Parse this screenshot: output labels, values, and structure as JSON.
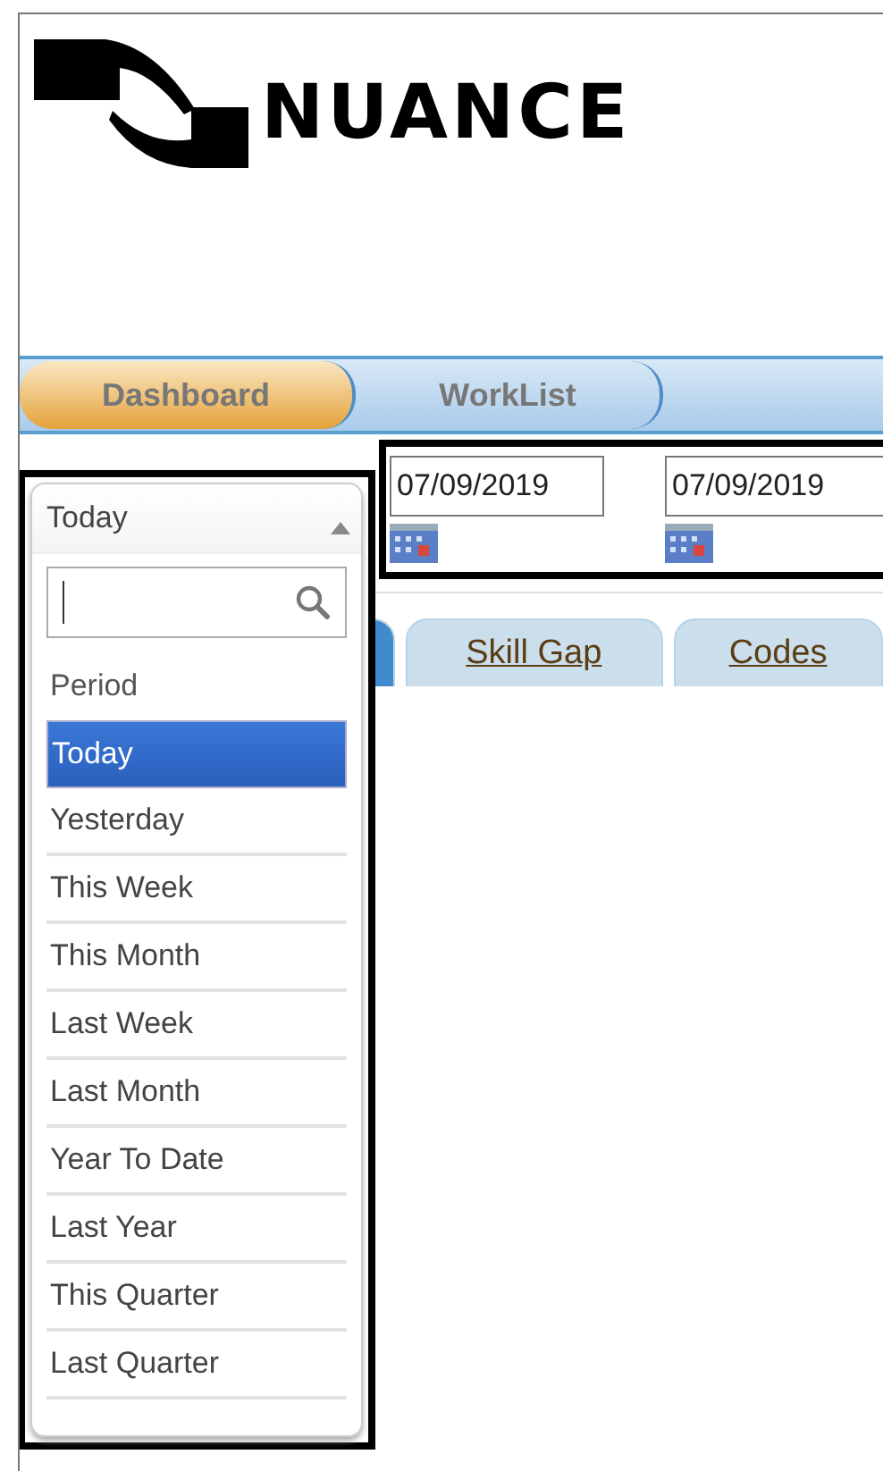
{
  "logo": {
    "text": "NUANCE"
  },
  "nav_tabs": [
    {
      "label": "Dashboard",
      "selected": true
    },
    {
      "label": "WorkList",
      "selected": false
    }
  ],
  "date_range": {
    "from": "07/09/2019",
    "to": "07/09/2019"
  },
  "sub_tabs": [
    {
      "selected": true
    },
    {
      "label": "Skill Gap",
      "selected": false
    },
    {
      "label": "Codes",
      "selected": false
    }
  ],
  "period_dropdown": {
    "value": "Today",
    "expanded": true,
    "options": [
      {
        "label": "Period",
        "kind": "header",
        "selected": false
      },
      {
        "label": "Today",
        "kind": "option",
        "selected": true
      },
      {
        "label": "Yesterday",
        "kind": "option",
        "selected": false
      },
      {
        "label": "This Week",
        "kind": "option",
        "selected": false
      },
      {
        "label": "This Month",
        "kind": "option",
        "selected": false
      },
      {
        "label": "Last Week",
        "kind": "option",
        "selected": false
      },
      {
        "label": "Last Month",
        "kind": "option",
        "selected": false
      },
      {
        "label": "Year To Date",
        "kind": "option",
        "selected": false
      },
      {
        "label": "Last Year",
        "kind": "option",
        "selected": false
      },
      {
        "label": "This Quarter",
        "kind": "option",
        "selected": false
      },
      {
        "label": "Last Quarter",
        "kind": "option",
        "selected": false
      }
    ]
  }
}
